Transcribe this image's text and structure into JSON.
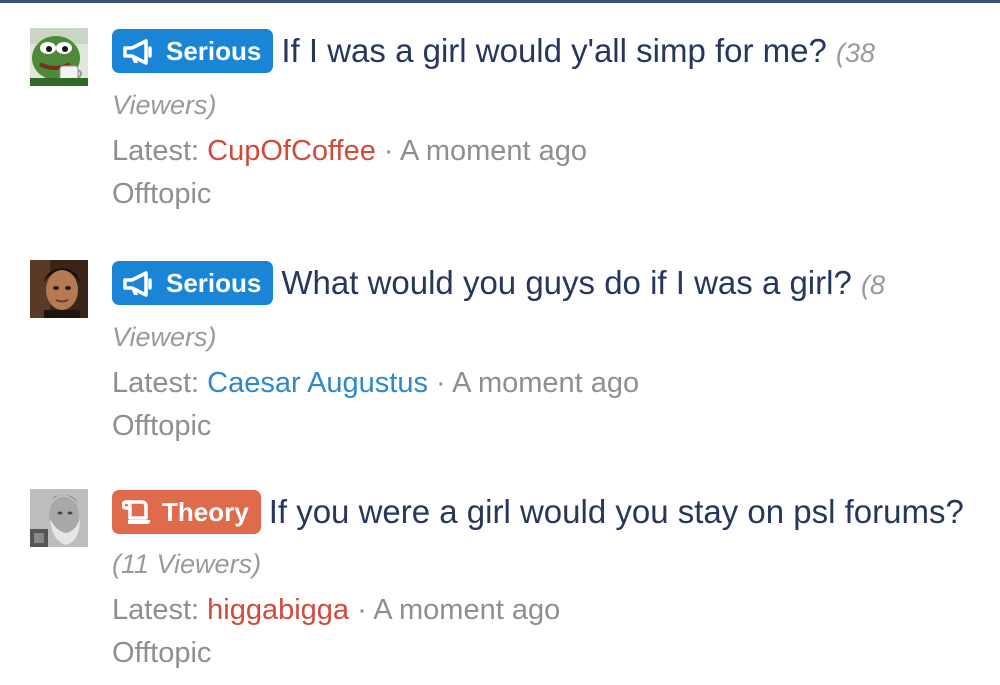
{
  "threads": [
    {
      "prefix": "Serious",
      "prefix_color": "#1a85d6",
      "prefix_icon": "megaphone-icon",
      "title": "If I was a girl would y'all simp for me?",
      "viewers": "(38 Viewers)",
      "latest_label": "Latest:",
      "latest_user": "CupOfCoffee",
      "latest_user_color": "#d24a3a",
      "separator": " · ",
      "time": "A moment ago",
      "forum": "Offtopic",
      "avatar": "pepe-avatar"
    },
    {
      "prefix": "Serious",
      "prefix_color": "#1a85d6",
      "prefix_icon": "megaphone-icon",
      "title": "What would you guys do if I was a girl?",
      "viewers": "(8 Viewers)",
      "latest_label": "Latest:",
      "latest_user": "Caesar Augustus",
      "latest_user_color": "#2f88cc",
      "separator": " · ",
      "time": "A moment ago",
      "forum": "Offtopic",
      "avatar": "man-portrait-avatar"
    },
    {
      "prefix": "Theory",
      "prefix_color": "#e06b4c",
      "prefix_icon": "scroll-icon",
      "title": "If you were a girl would you stay on psl forums?",
      "viewers": "(11 Viewers)",
      "latest_label": "Latest:",
      "latest_user": "higgabigga",
      "latest_user_color": "#d24a3a",
      "separator": " · ",
      "time": "A moment ago",
      "forum": "Offtopic",
      "avatar": "bearded-man-avatar"
    }
  ]
}
